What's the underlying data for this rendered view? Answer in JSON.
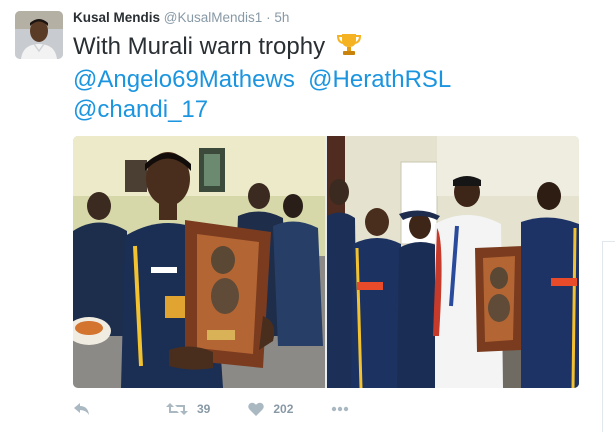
{
  "tweet": {
    "author_name": "Kusal Mendis",
    "author_handle": "@KusalMendis1",
    "separator": "·",
    "time": "5h",
    "text_line1": "With Murali warn trophy",
    "emoji": "trophy-icon",
    "mentions": [
      "@Angelo69Mathews",
      "@HerathRSL",
      "@chandi_17"
    ],
    "photos": [
      "player-holding-trophy-photo",
      "team-group-with-trophy-photo"
    ]
  },
  "actions": {
    "reply_icon": "reply-icon",
    "retweet_icon": "retweet-icon",
    "retweet_count": "39",
    "like_icon": "heart-icon",
    "like_count": "202",
    "more_icon": "more-icon"
  },
  "colors": {
    "link": "#1b95e0",
    "name": "#292f33",
    "meta": "#8899a6",
    "icon": "#aab8c2"
  }
}
